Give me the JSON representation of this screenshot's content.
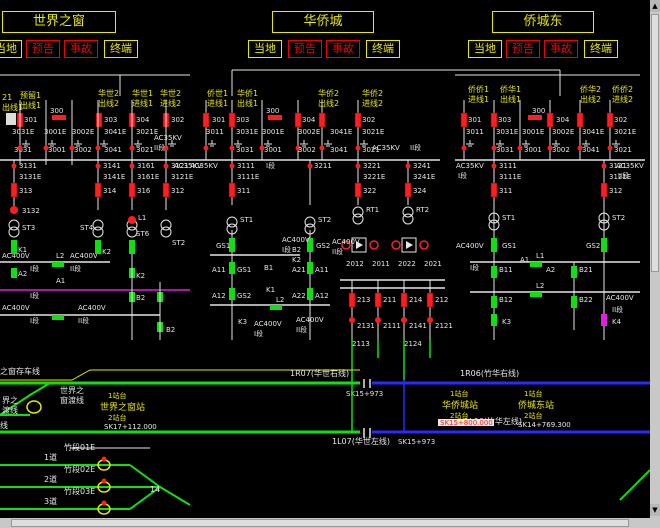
{
  "stations": [
    {
      "title": "世界之窗",
      "buttons": [
        "当地",
        "预告",
        "事故",
        "终端"
      ]
    },
    {
      "title": "华侨城",
      "buttons": [
        "当地",
        "预告",
        "事故",
        "终端"
      ]
    },
    {
      "title": "侨城东",
      "buttons": [
        "当地",
        "预告",
        "事故",
        "终端"
      ]
    }
  ],
  "colors": {
    "yellow": "#e8e800",
    "red": "#ff1e1e",
    "green": "#10e010",
    "white": "#e6e6e6",
    "blue": "#2a2aff",
    "magenta": "#e020e0"
  },
  "left_panel": {
    "feeder_labels": [
      "21",
      "出线1",
      "预留1",
      "出线1",
      "华世2",
      "出线2",
      "华世1",
      "进线1",
      "华世2",
      "进线2"
    ],
    "device_codes": [
      "301",
      "303",
      "300",
      "304",
      "302",
      "3011",
      "3031E",
      "3001E",
      "3002E",
      "3041E",
      "3021E",
      "3031",
      "3001",
      "3002",
      "3041",
      "3021",
      "3131",
      "3131E",
      "313",
      "3141",
      "3141E",
      "314",
      "3161",
      "3161E",
      "316",
      "3121",
      "3121E",
      "312",
      "3132",
      "ST3",
      "ST4",
      "ST6",
      "ST2",
      "ST62",
      "L1",
      "L2",
      "A1",
      "K1",
      "A2",
      "K2",
      "B2"
    ],
    "bus_labels": [
      "AC35KV",
      "II段",
      "AC35KV",
      "AC400V",
      "I段",
      "AC400V",
      "II段",
      "AC400V",
      "I段",
      "AC400V",
      "II段"
    ]
  },
  "middle_panel": {
    "feeder_labels": [
      "侨世1",
      "进线1",
      "华侨1",
      "出线1",
      "华侨2",
      "出线2",
      "华侨2",
      "进线2"
    ],
    "device_codes": [
      "301",
      "303",
      "300",
      "304",
      "302",
      "3011",
      "3031E",
      "3001E",
      "3002E",
      "3041E",
      "3021E",
      "3031",
      "3001",
      "3002",
      "3041",
      "3021",
      "3111",
      "3111E",
      "311",
      "3221",
      "3221E",
      "322",
      "3241",
      "3241E",
      "324",
      "3211",
      "ST1",
      "ST2",
      "RT1",
      "RT2",
      "GS1",
      "GS2",
      "A11",
      "A12",
      "A21",
      "A22",
      "B1",
      "B2",
      "K1",
      "K2",
      "K3",
      "L2",
      "2012",
      "2011",
      "2022",
      "2021",
      "213",
      "211",
      "214",
      "212",
      "2131",
      "2111",
      "2141",
      "2121",
      "2113",
      "2124"
    ],
    "bus_labels": [
      "AC35KV",
      "I段",
      "AC35KV",
      "II段",
      "AC400V",
      "I段",
      "AC400V",
      "II段",
      "AC400V",
      "I段",
      "AC400V",
      "II段"
    ]
  },
  "right_panel": {
    "feeder_labels": [
      "侨侨1",
      "进线1",
      "侨华1",
      "出线1",
      "侨华2",
      "出线2",
      "侨侨2",
      "进线2"
    ],
    "device_codes": [
      "301",
      "303",
      "300",
      "304",
      "302",
      "3011",
      "3031E",
      "3001E",
      "3002E",
      "3041E",
      "3021E",
      "3031",
      "3001",
      "3002",
      "3041",
      "3021",
      "3111",
      "3111E",
      "311",
      "3121",
      "3121E",
      "312",
      "ST1",
      "ST2",
      "GS1",
      "GS2",
      "A1",
      "A2",
      "B11",
      "B12",
      "B21",
      "B22",
      "K3",
      "K4",
      "L1",
      "L2",
      "1K1"
    ],
    "bus_labels": [
      "AC35KV",
      "I段",
      "AC35KV",
      "II段",
      "AC400V",
      "I段",
      "AC400V",
      "II段"
    ]
  },
  "track": {
    "labels": [
      "之窗存车线",
      "1R07(华世右线)",
      "SK15+973",
      "1R06(竹华右线)",
      "世界之",
      "窗渡线",
      "界之",
      "渡线",
      "线",
      "1站台",
      "世界之窗站",
      "2站台",
      "SK17+112.000",
      "1站台",
      "华侨城站",
      "2站台",
      "SK15+800.000",
      "1站台",
      "侨城东站",
      "2站台",
      "SK14+769.300",
      "1L07(华世左线)",
      "SK15+973",
      "1L06(竹华左线)",
      "1道",
      "2道",
      "3道",
      "竹段01E",
      "竹段02E",
      "竹段03E",
      "14"
    ]
  }
}
